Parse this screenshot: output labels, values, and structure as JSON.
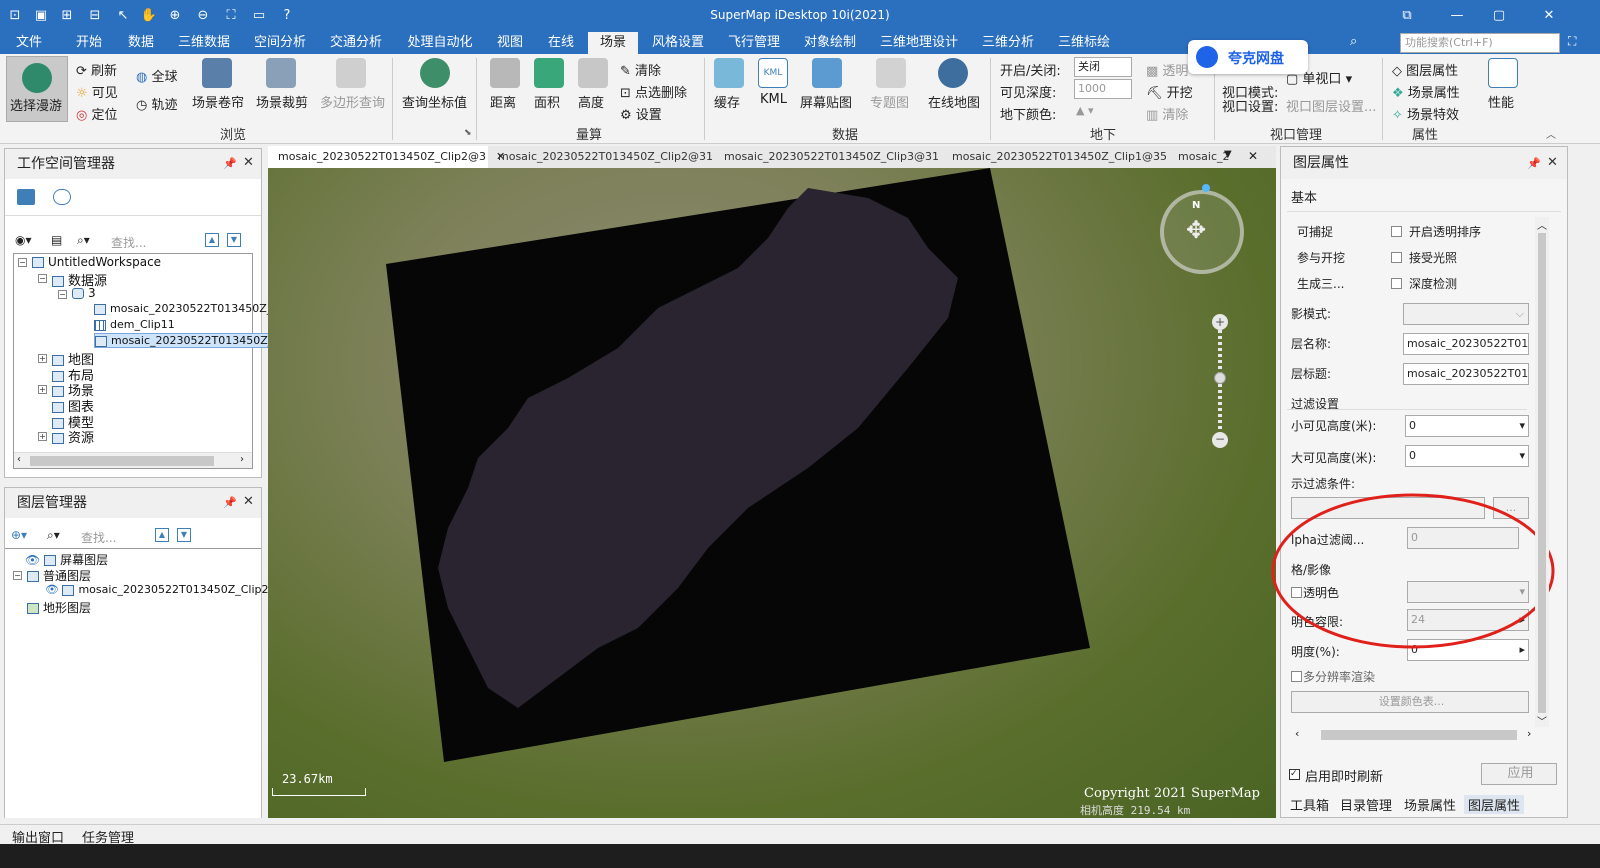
{
  "app": {
    "title": "SuperMap iDesktop 10i(2021)"
  },
  "menus": [
    "文件",
    "开始",
    "数据",
    "三维数据",
    "空间分析",
    "交通分析",
    "处理自动化",
    "视图",
    "在线",
    "场景",
    "风格设置",
    "飞行管理",
    "对象绘制",
    "三维地理设计",
    "三维分析",
    "三维标绘"
  ],
  "search_placeholder": "功能搜索(Ctrl+F)",
  "ribbon": {
    "browse": {
      "select_roam": "选择漫游",
      "refresh": "刷新",
      "visible": "可见",
      "locate": "定位",
      "fullextent": "全球",
      "track": "轨迹",
      "scene_roller": "场景卷帘",
      "scene_clip": "场景裁剪",
      "polygon_query": "多边形查询",
      "query_coord": "查询坐标值",
      "label": "浏览"
    },
    "measure": {
      "distance": "距离",
      "area": "面积",
      "height": "高度",
      "clear": "清除",
      "point_delete": "点选删除",
      "settings": "设置",
      "label": "量算"
    },
    "data": {
      "cache": "缓存",
      "kml": "KML",
      "screen_overlay": "屏幕贴图",
      "thematic": "专题图",
      "online_map": "在线地图",
      "label": "数据"
    },
    "underground": {
      "open_close": "开启/关闭:",
      "visible_depth": "可见深度:",
      "ground_color": "地下颜色:",
      "state": "关闭",
      "depth": "1000",
      "transparent": "透明",
      "excavate": "开挖",
      "clear": "清除",
      "label": "地下"
    },
    "viewport": {
      "viewport_mode": "视口模式:",
      "single": "单视口",
      "viewport_settings": "视口设置:",
      "layer_settings": "视口图层设置...",
      "label": "视口管理"
    },
    "properties": {
      "layer_props": "图层属性",
      "scene_props": "场景属性",
      "scene_effects": "场景特效",
      "performance": "性能",
      "label": "属性"
    }
  },
  "overlay_badge": "夸克网盘",
  "workspace": {
    "title": "工作空间管理器",
    "search": "查找...",
    "tree": {
      "root": "UntitledWorkspace",
      "datasources": "数据源",
      "ds": "3",
      "items": [
        "mosaic_20230522T013450Z_",
        "dem_Clip11",
        "mosaic_20230522T013450Z_"
      ],
      "maps": "地图",
      "layouts": "布局",
      "scenes": "场景",
      "charts": "图表",
      "models": "模型",
      "resources": "资源"
    }
  },
  "layers": {
    "title": "图层管理器",
    "search": "查找...",
    "screen": "屏幕图层",
    "normal": "普通图层",
    "layer": "mosaic_20230522T013450Z_Clip2@3",
    "terrain": "地形图层"
  },
  "doc_tabs": [
    "mosaic_20230522T013450Z_Clip2@3",
    "mosaic_20230522T013450Z_Clip2@31",
    "mosaic_20230522T013450Z_Clip3@31",
    "mosaic_20230522T013450Z_Clip1@35",
    "mosaic_2"
  ],
  "scene": {
    "scale": "23.67km",
    "copyright": "Copyright 2021 SuperMap",
    "altitude": "相机高度 219.54 km",
    "compass": "N"
  },
  "props": {
    "title": "图层属性",
    "section_basic": "基本",
    "selectable": "可捕捉",
    "transparent_sort": "开启透明排序",
    "cast": "参与开挖",
    "lighting": "接受光照",
    "gen3d": "生成三...",
    "depth_test": "深度检测",
    "shadow_mode": "影模式:",
    "layer_name": "层名称:",
    "layer_name_val": "mosaic_20230522T01345",
    "layer_caption": "层标题:",
    "layer_caption_val": "mosaic_20230522T01345",
    "filter": "过滤设置",
    "min_h": "小可见高度(米):",
    "min_h_val": "0",
    "max_h": "大可见高度(米):",
    "max_h_val": "0",
    "display_filter": "示过滤条件:",
    "more": "...",
    "alpha": "lpha过滤阈...",
    "alpha_val": "0",
    "raster": "格/影像",
    "trans_color": "透明色",
    "tolerance": "明色容限:",
    "tolerance_val": "24",
    "opacity": "明度(%):",
    "opacity_val": "0",
    "multires": "多分辨率渲染",
    "color_table": "设置颜色表...",
    "realtime": "启用即时刷新",
    "apply": "应用"
  },
  "bottom_tabs": [
    "工具箱",
    "目录管理",
    "场景属性",
    "图层属性"
  ],
  "status": {
    "output": "输出窗口",
    "tasks": "任务管理"
  }
}
